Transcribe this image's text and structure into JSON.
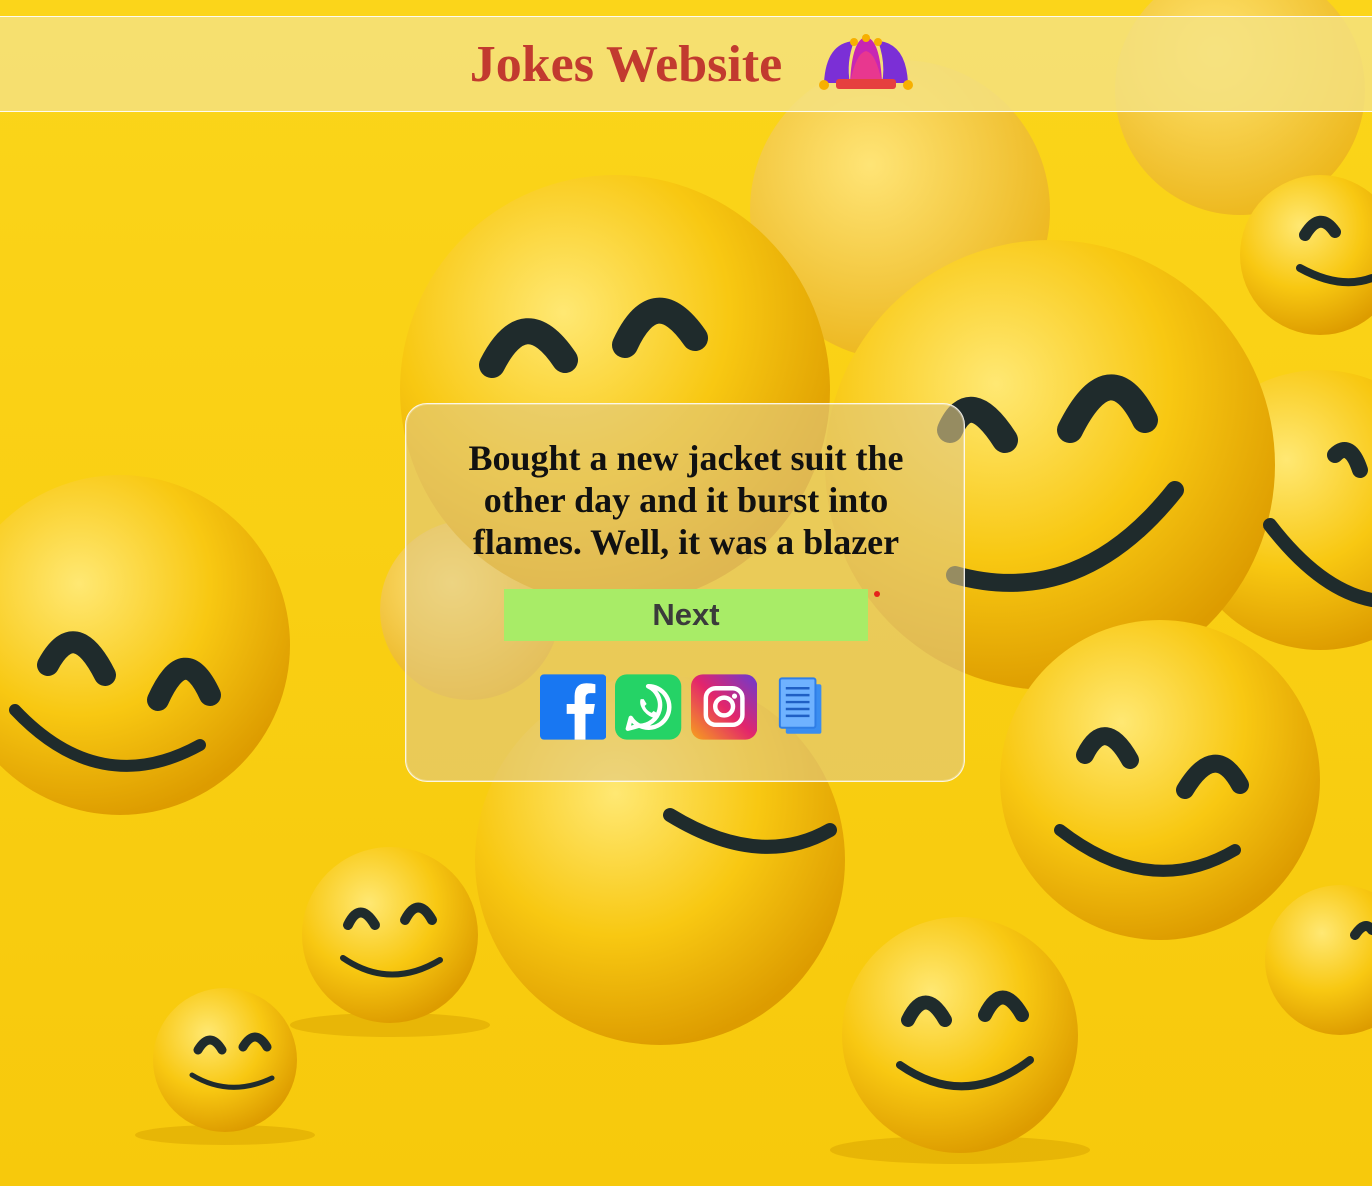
{
  "header": {
    "title": "Jokes Website",
    "title_color": "#c23a2f",
    "logo_icon": "jester-hat-icon"
  },
  "card": {
    "joke_text": "Bought a new jacket suit the other day and it burst into flames. Well, it was a blazer",
    "next_label": "Next",
    "next_color": "#a8ec67"
  },
  "share": {
    "icons": [
      "facebook-icon",
      "whatsapp-icon",
      "instagram-icon",
      "copy-document-icon"
    ],
    "facebook_color": "#1877f2",
    "whatsapp_color": "#25d366",
    "instagram_colors": [
      "#6a3bd1",
      "#e3256b",
      "#f7a21b"
    ]
  },
  "background": {
    "color": "#f7cf12",
    "description_icon": "smiley-balls-background"
  }
}
